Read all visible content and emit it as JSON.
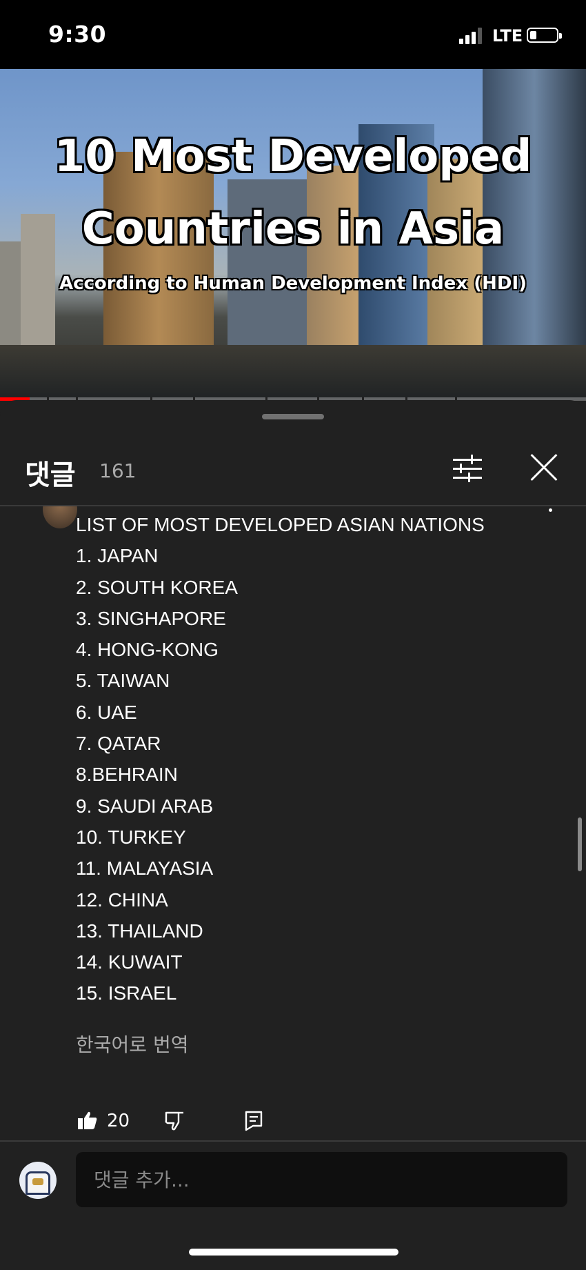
{
  "status_bar": {
    "time": "9:30",
    "network": "LTE"
  },
  "video": {
    "title_line1": "10 Most Developed",
    "title_line2": "Countries in Asia",
    "subtitle": "According to Human Development Index (HDI)",
    "progress_fraction": 0.05
  },
  "comments_panel": {
    "title": "댓글",
    "count": "161"
  },
  "comment": {
    "lines": [
      "LIST OF MOST DEVELOPED ASIAN NATIONS",
      "1. JAPAN",
      "2. SOUTH KOREA",
      "3. SINGHAPORE",
      "4. HONG-KONG",
      "5. TAIWAN",
      "6. UAE",
      "7. QATAR",
      "8.BEHRAIN",
      "9. SAUDI ARAB",
      "10. TURKEY",
      "11. MALAYASIA",
      "12. CHINA",
      "13. THAILAND",
      "14. KUWAIT",
      "15. ISRAEL"
    ],
    "translate_label": "한국어로 번역",
    "like_count": "20"
  },
  "add_comment": {
    "placeholder": "댓글 추가..."
  },
  "icons": {
    "filter": "sliders-icon",
    "close": "close-icon",
    "like": "thumbs-up-icon",
    "dislike": "thumbs-down-icon",
    "reply": "reply-icon"
  }
}
